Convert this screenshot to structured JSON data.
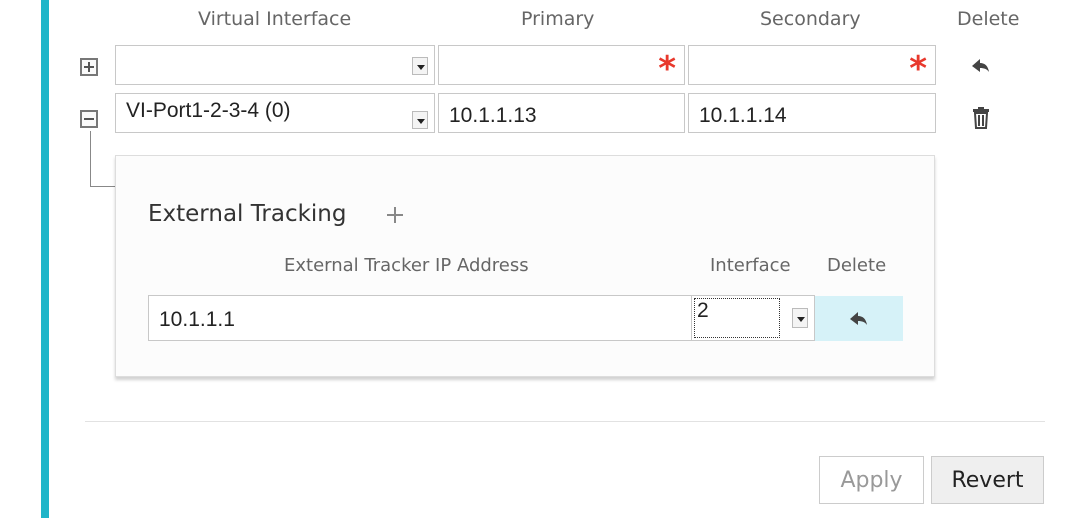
{
  "table": {
    "headers": {
      "virtual_interface": "Virtual Interface",
      "primary": "Primary",
      "secondary": "Secondary",
      "delete": "Delete"
    },
    "new_row": {
      "virtual_interface": "",
      "primary": "",
      "secondary": "",
      "required_marker": "*"
    },
    "rows": [
      {
        "virtual_interface": "VI-Port1-2-3-4 (0)",
        "primary": "10.1.1.13",
        "secondary": "10.1.1.14"
      }
    ]
  },
  "external_tracking": {
    "title": "External Tracking",
    "headers": {
      "ip": "External Tracker IP Address",
      "interface": "Interface",
      "delete": "Delete"
    },
    "rows": [
      {
        "ip": "10.1.1.1",
        "interface": "2"
      }
    ]
  },
  "actions": {
    "apply": "Apply",
    "revert": "Revert"
  },
  "colors": {
    "accent": "#1fb5c9",
    "required": "#e8382c",
    "delete_highlight": "#d6f2f8"
  },
  "icons": {
    "expand": "plus-box-icon",
    "collapse": "minus-box-icon",
    "undo": "undo-arrow-icon",
    "delete": "trash-icon",
    "add": "plus-icon"
  }
}
